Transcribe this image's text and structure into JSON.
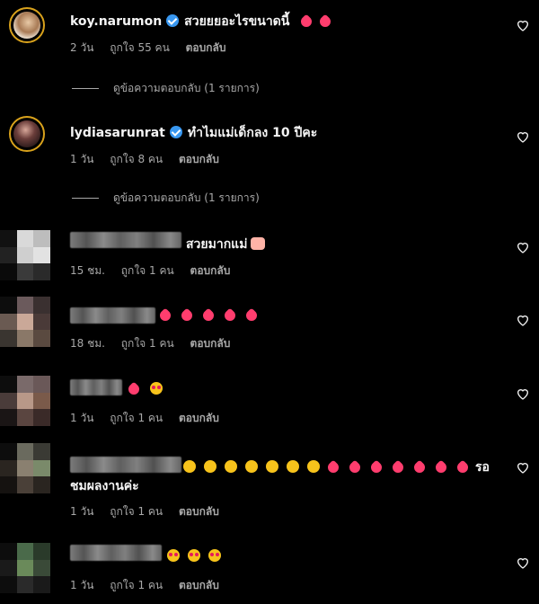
{
  "comments": [
    {
      "username": "koy.narumon",
      "verified": true,
      "text": "สวยยยอะไรขนาดนี้",
      "time": "2 วัน",
      "likes": "ถูกใจ 55 คน",
      "reply": "ตอบกลับ",
      "view_replies": "ดูข้อความตอบกลับ (1 รายการ)"
    },
    {
      "username": "lydiasarunrat",
      "verified": true,
      "text": "ทำไมแม่เด็กลง 10 ปีคะ",
      "time": "1 วัน",
      "likes": "ถูกใจ 8 คน",
      "reply": "ตอบกลับ",
      "view_replies": "ดูข้อความตอบกลับ (1 รายการ)"
    },
    {
      "text": "สวยมากแม่",
      "time": "15 ชม.",
      "likes": "ถูกใจ 1 คน",
      "reply": "ตอบกลับ"
    },
    {
      "text": "",
      "time": "18 ชม.",
      "likes": "ถูกใจ 1 คน",
      "reply": "ตอบกลับ"
    },
    {
      "text": "",
      "time": "1 วัน",
      "likes": "ถูกใจ 1 คน",
      "reply": "ตอบกลับ"
    },
    {
      "text": "รอ",
      "text2": "ชมผลงานค่ะ",
      "time": "1 วัน",
      "likes": "ถูกใจ 1 คน",
      "reply": "ตอบกลับ"
    },
    {
      "text": "",
      "time": "1 วัน",
      "likes": "ถูกใจ 1 คน",
      "reply": "ตอบกลับ"
    }
  ],
  "icons": {
    "like": "heart-outline-icon",
    "verified": "verified-badge-icon"
  },
  "colors": {
    "background": "#000000",
    "meta": "#a8a8a8",
    "verified": "#3897f0",
    "heart_emoji": "#ff3d6e"
  }
}
